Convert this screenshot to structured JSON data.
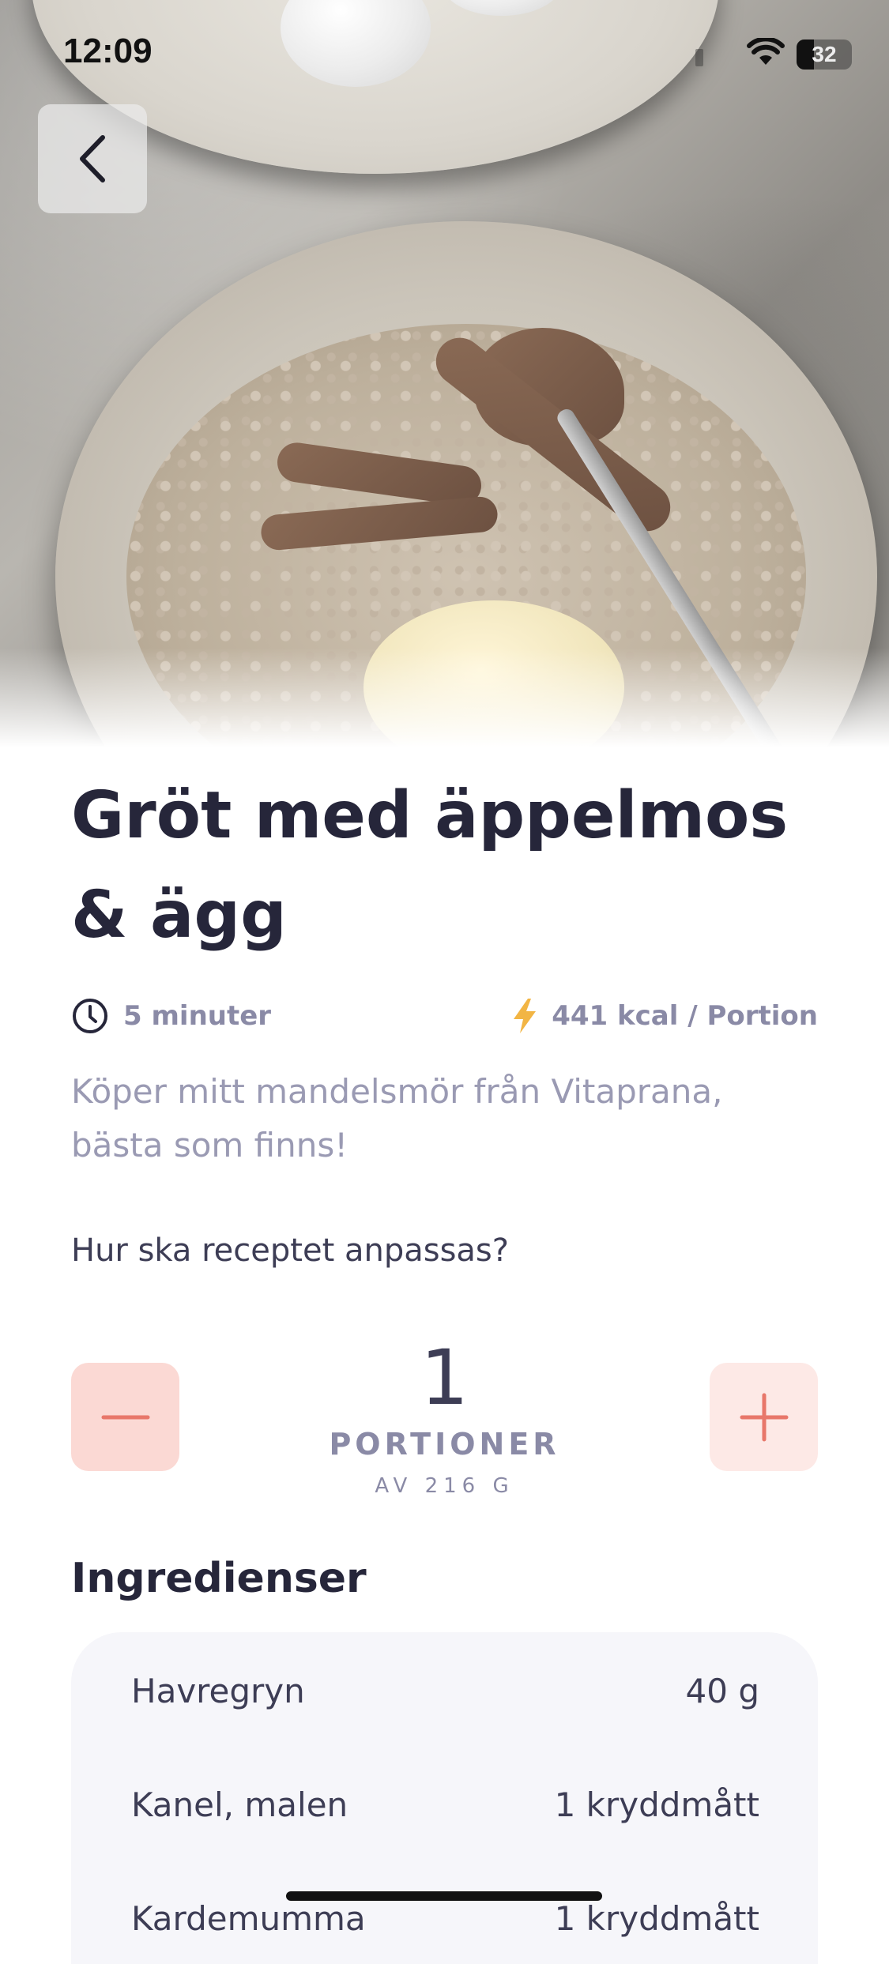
{
  "status_bar": {
    "time": "12:09",
    "battery": "32"
  },
  "nav": {
    "back_icon": "chevron-left-icon"
  },
  "recipe": {
    "title": "Gröt med äppelmos & ägg",
    "time_label": "5 minuter",
    "time_icon": "clock-icon",
    "kcal_label": "441 kcal / Portion",
    "kcal_icon": "lightning-icon",
    "description": "Köper mitt mandelsmör från Vitaprana, bästa som finns!"
  },
  "adjust": {
    "question": "Hur ska receptet anpassas?",
    "count": "1",
    "unit_label": "PORTIONER",
    "weight_label": "AV 216 G"
  },
  "ingredients": {
    "title": "Ingredienser",
    "items": [
      {
        "name": "Havregryn",
        "amount": "40 g"
      },
      {
        "name": "Kanel, malen",
        "amount": "1 kryddmått"
      },
      {
        "name": "Kardemumma",
        "amount": "1 kryddmått"
      }
    ]
  },
  "colors": {
    "accent": "#e8776a",
    "kcal_icon": "#f2b544",
    "title": "#26263a",
    "muted": "#8a8aa6"
  }
}
